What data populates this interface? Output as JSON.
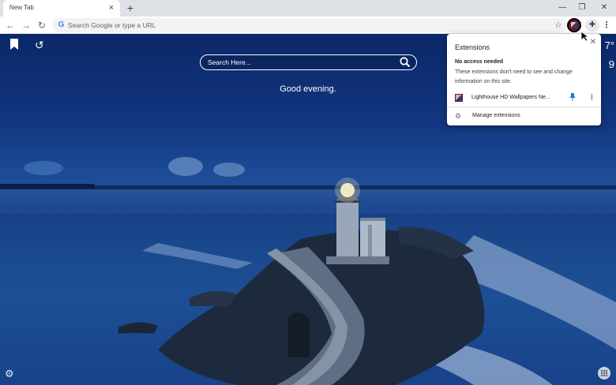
{
  "tab": {
    "title": "New Tab",
    "close_glyph": "×",
    "new_tab_glyph": "+"
  },
  "window_controls": {
    "minimize": "—",
    "restore": "❐",
    "close": "✕"
  },
  "toolbar": {
    "back_glyph": "←",
    "forward_glyph": "→",
    "reload_glyph": "↻",
    "google_glyph": "G",
    "omnibox_placeholder": "Search Google or type a URL",
    "star_glyph": "☆",
    "puzzle_glyph": "✚",
    "menu_glyph": "⋮"
  },
  "newtab": {
    "bookmark_glyph": "🔖",
    "history_glyph": "↺",
    "search_placeholder": "Search Here...",
    "greeting": "Good evening.",
    "weather_partial_1": "7°",
    "weather_partial_2": "9",
    "settings_glyph": "⚙"
  },
  "extensions_popup": {
    "title": "Extensions",
    "close_glyph": "✕",
    "section_heading": "No access needed",
    "section_desc": "These extensions don't need to see and change information on this site.",
    "extension_name": "Lighthouse HD Wallpapers Ne...",
    "pin_glyph": "📌",
    "more_glyph": "⋮",
    "manage_glyph": "⚙",
    "manage_label": "Manage extensions"
  },
  "colors": {
    "accent_pin": "#1a73e8",
    "wallpaper_base": "#12367f"
  },
  "icons": [
    "back-arrow-icon",
    "forward-arrow-icon",
    "reload-icon",
    "google-icon",
    "star-icon",
    "extension-avatar-icon",
    "puzzle-icon",
    "menu-dots-icon",
    "bookmark-icon",
    "history-icon",
    "search-icon",
    "settings-gear-icon",
    "apps-grid-icon",
    "pin-icon",
    "close-icon"
  ]
}
